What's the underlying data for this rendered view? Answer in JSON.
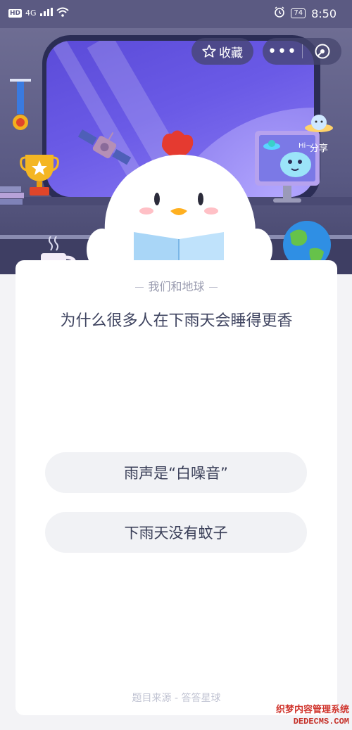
{
  "status_bar": {
    "network_label": "HD",
    "signal_label": "4G",
    "battery_level": "74",
    "time": "8:50"
  },
  "toolbar": {
    "favorite_label": "收藏",
    "more_label": "•••",
    "share_label": "分享"
  },
  "hero": {
    "monitor_greeting": "Hi~"
  },
  "quiz": {
    "category": "我们和地球",
    "question": "为什么很多人在下雨天会睡得更香",
    "options": [
      {
        "label": "雨声是“白噪音”"
      },
      {
        "label": "下雨天没有蚊子"
      }
    ],
    "source": "题目来源 - 答答星球"
  },
  "watermark": {
    "line1": "织梦内容管理系统",
    "line2": "DEDECMS.COM"
  },
  "colors": {
    "status_bar": "#5b5a82",
    "card_bg": "#ffffff",
    "option_bg": "#f1f2f5",
    "question_text": "#3f4460"
  }
}
